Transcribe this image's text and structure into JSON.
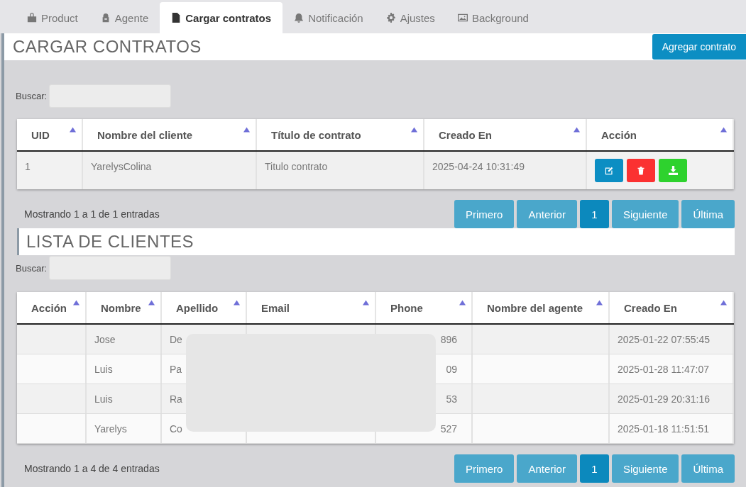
{
  "tabs": [
    {
      "label": "Product",
      "selected": false
    },
    {
      "label": "Agente",
      "selected": false
    },
    {
      "label": "Cargar contratos",
      "selected": true
    },
    {
      "label": "Notificación",
      "selected": false
    },
    {
      "label": "Ajustes",
      "selected": false
    },
    {
      "label": "Background",
      "selected": false
    }
  ],
  "contracts": {
    "title": "CARGAR CONTRATOS",
    "add_button": "Agregar contrato",
    "search_label": "Buscar:",
    "columns": [
      "UID",
      "Nombre del cliente",
      "Título de contrato",
      "Creado En",
      "Acción"
    ],
    "rows": [
      {
        "cells": [
          "1",
          "YarelysColina",
          "Titulo contrato",
          "2025-04-24 10:31:49"
        ]
      }
    ],
    "info": "Mostrando 1 a 1 de 1 entradas",
    "pages": [
      {
        "label": "Primero",
        "selected": false
      },
      {
        "label": "Anterior",
        "selected": false
      },
      {
        "label": "1",
        "selected": true
      },
      {
        "label": "Siguiente",
        "selected": false
      },
      {
        "label": "Última",
        "selected": false
      }
    ]
  },
  "clients": {
    "title": "LISTA DE CLIENTES",
    "search_label": "Buscar:",
    "columns": [
      "Acción",
      "Nombre",
      "Apellido",
      "Email",
      "Phone",
      "Nombre del agente",
      "Creado En"
    ],
    "rows": [
      {
        "cells": [
          "",
          "Jose",
          "De",
          "",
          "896",
          "",
          "2025-01-22 07:55:45"
        ]
      },
      {
        "cells": [
          "",
          "Luis",
          "Pa",
          "",
          "09",
          "",
          "2025-01-28 11:47:07"
        ]
      },
      {
        "cells": [
          "",
          "Luis",
          "Ra",
          "",
          "53",
          "",
          "2025-01-29 20:31:16"
        ]
      },
      {
        "cells": [
          "",
          "Yarelys",
          "Co",
          "",
          "527",
          "",
          "2025-01-18 11:51:51"
        ]
      }
    ],
    "info": "Mostrando 1 a 4 de 4 entradas",
    "pages": [
      {
        "label": "Primero",
        "selected": false
      },
      {
        "label": "Anterior",
        "selected": false
      },
      {
        "label": "1",
        "selected": true
      },
      {
        "label": "Siguiente",
        "selected": false
      },
      {
        "label": "Última",
        "selected": false
      }
    ]
  }
}
